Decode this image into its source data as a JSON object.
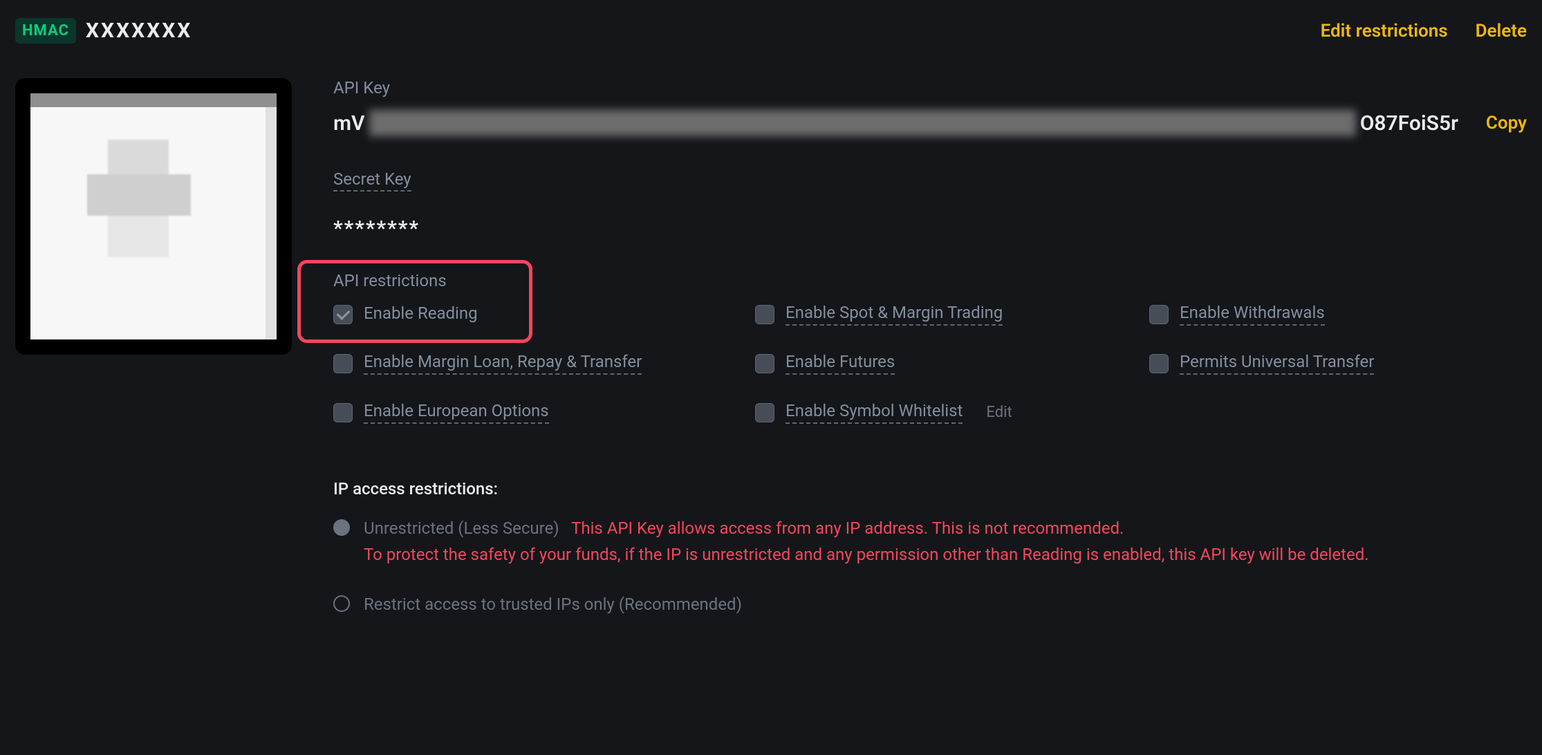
{
  "header": {
    "badge": "HMAC",
    "key_name": "XXXXXXX",
    "edit_restrictions": "Edit restrictions",
    "delete": "Delete"
  },
  "api_key": {
    "label": "API Key",
    "prefix": "mV",
    "suffix": "O87FoiS5r",
    "copy": "Copy"
  },
  "secret_key": {
    "label": "Secret Key",
    "value": "********"
  },
  "restrictions": {
    "title": "API restrictions",
    "items": [
      {
        "id": "enable-reading",
        "label": "Enable Reading",
        "checked": true,
        "highlighted": true
      },
      {
        "id": "enable-spot-margin",
        "label": "Enable Spot & Margin Trading",
        "checked": false
      },
      {
        "id": "enable-withdrawals",
        "label": "Enable Withdrawals",
        "checked": false
      },
      {
        "id": "enable-margin-loan",
        "label": "Enable Margin Loan, Repay & Transfer",
        "checked": false
      },
      {
        "id": "enable-futures",
        "label": "Enable Futures",
        "checked": false
      },
      {
        "id": "permits-universal-transfer",
        "label": "Permits Universal Transfer",
        "checked": false
      },
      {
        "id": "enable-european-options",
        "label": "Enable European Options",
        "checked": false
      },
      {
        "id": "enable-symbol-whitelist",
        "label": "Enable Symbol Whitelist",
        "checked": false,
        "edit": "Edit"
      }
    ]
  },
  "ip": {
    "title": "IP access restrictions:",
    "options": [
      {
        "id": "unrestricted",
        "selected": true,
        "label_muted": "Unrestricted (Less Secure)",
        "warning_inline": "This API Key allows access from any IP address. This is not recommended.",
        "warning_block": "To protect the safety of your funds, if the IP is unrestricted and any permission other than Reading is enabled, this API key will be deleted."
      },
      {
        "id": "trusted-ips",
        "selected": false,
        "label_muted": "Restrict access to trusted IPs only (Recommended)"
      }
    ]
  }
}
